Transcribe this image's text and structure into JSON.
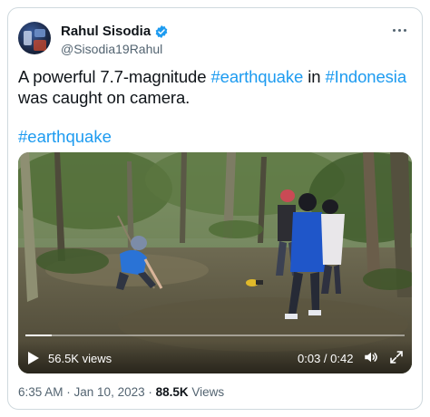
{
  "author": {
    "name": "Rahul Sisodia",
    "handle": "@Sisodia19Rahul"
  },
  "tweet": {
    "line1_prefix": "A powerful 7.7-magnitude ",
    "hashtag1": "#earthquake",
    "mid": " in ",
    "hashtag2": "#Indonesia",
    "line2": "was caught on camera.",
    "hashtag3": "#earthquake"
  },
  "video": {
    "views": "56.5K views",
    "time": "0:03 / 0:42",
    "progress": 0.07
  },
  "meta": {
    "time": "6:35 AM",
    "sep1": " · ",
    "date": "Jan 10, 2023",
    "sep2": " · ",
    "view_count": "88.5K",
    "views_label": " Views"
  },
  "colors": {
    "link": "#1d9bf0",
    "verified": "#1d9bf0",
    "secondary": "#536471",
    "border": "#cfd9de"
  },
  "icons": [
    "verified-badge-icon",
    "more-icon",
    "play-icon",
    "volume-icon",
    "fullscreen-icon"
  ]
}
